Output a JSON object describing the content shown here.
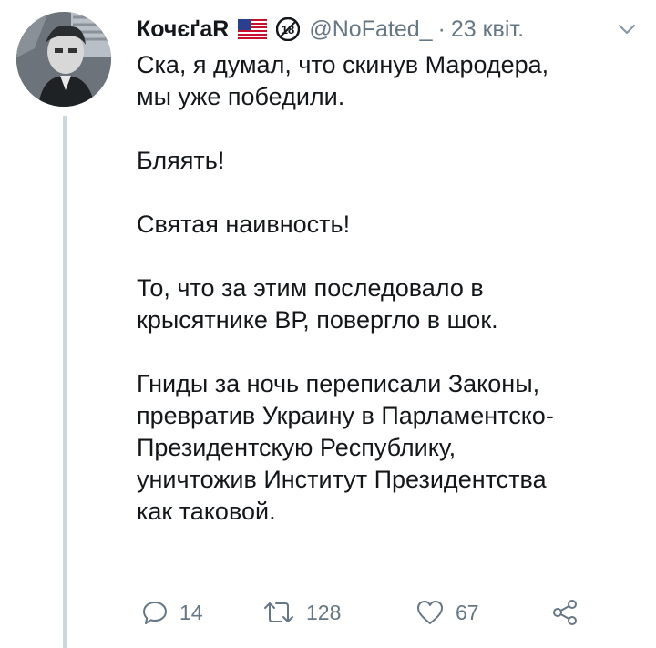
{
  "tweet": {
    "author_name": "КочєґаR",
    "handle": "@NoFated_",
    "separator": "·",
    "date": "23 квіт.",
    "paragraphs": [
      "Ска, я думал, что скинув Мародера,\nмы уже победили.",
      "Бляять!",
      "Святая наивность!",
      "То, что за этим последовало в\nкрысятнике ВР, повергло в шок.",
      "Гниды за ночь переписали Законы,\nпревратив Украину в Парламентско-\nПрезидентскую Республику,\nуничтожив Институт Президентства\nкак таковой."
    ]
  },
  "badge": {
    "text": "18"
  },
  "stats": {
    "replies": "14",
    "retweets": "128",
    "likes": "67"
  },
  "icons": {
    "flag": "us-flag-icon",
    "age_badge": "age-18-badge-icon",
    "caret": "chevron-down-icon",
    "reply": "reply-icon",
    "retweet": "retweet-icon",
    "like": "heart-icon",
    "share": "share-icon"
  },
  "colors": {
    "text": "#14171a",
    "muted": "#657786",
    "thread_line": "#ccd6dd"
  }
}
